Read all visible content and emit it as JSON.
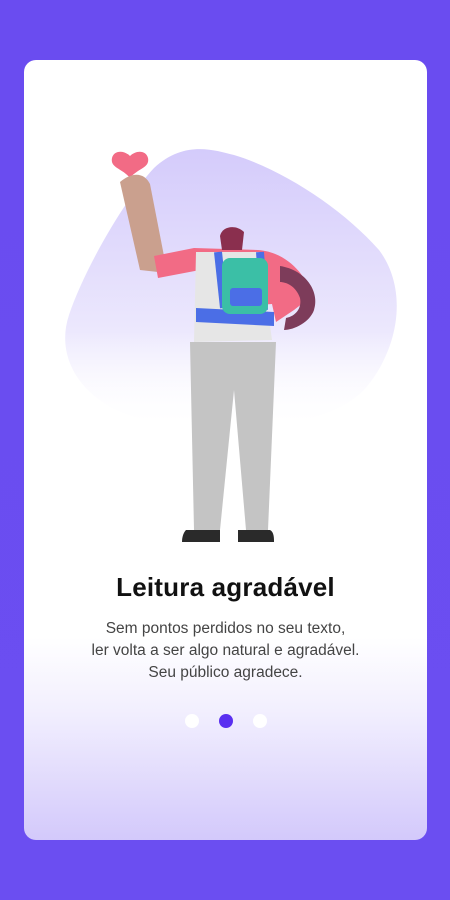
{
  "onboarding": {
    "title": "Leitura agradável",
    "description_lines": [
      "Sem pontos perdidos no seu texto,",
      "ler volta a ser algo natural e agradável.",
      "Seu público agradece."
    ],
    "pager": {
      "total": 3,
      "active_index": 1
    }
  },
  "colors": {
    "background": "#6a4cf0",
    "accent": "#5a2ff0",
    "blob": "#ddd6fb",
    "heart": "#f26b85",
    "shirt": "#f26b85",
    "backpack": "#3bbfa6",
    "strap": "#4b6ee6",
    "pants": "#c4c4c4"
  },
  "icons": {
    "illustration": "person-with-heart-illustration"
  }
}
